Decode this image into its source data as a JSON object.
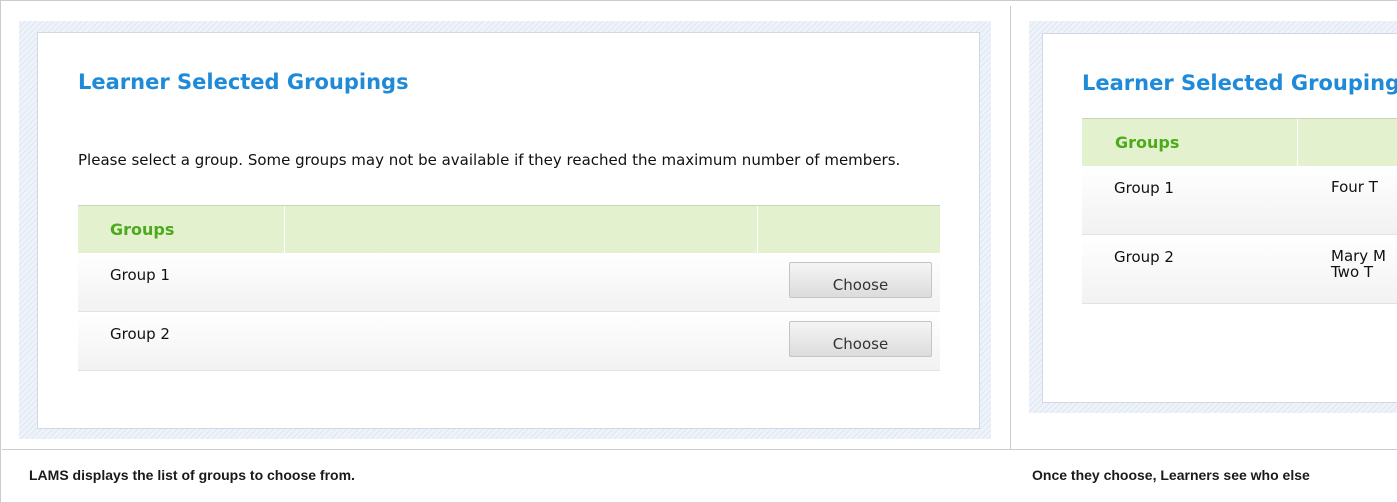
{
  "left_panel": {
    "title": "Learner Selected Groupings",
    "instructions": "Please select a group. Some groups may not be available if they reached the maximum number of members.",
    "table": {
      "header": "Groups",
      "rows": [
        {
          "name": "Group 1",
          "button": "Choose"
        },
        {
          "name": "Group 2",
          "button": "Choose"
        }
      ]
    },
    "caption": "LAMS displays the list of groups to choose from."
  },
  "right_panel": {
    "title": "Learner Selected Groupings",
    "table": {
      "header": "Groups",
      "rows": [
        {
          "name": "Group 1",
          "members": [
            "Four T"
          ]
        },
        {
          "name": "Group 2",
          "members": [
            "Mary M",
            "Two T"
          ]
        }
      ]
    },
    "caption": "Once they choose, Learners see who else"
  },
  "colors": {
    "title": "#1f8ad8",
    "table_header_bg": "#e3f1cf",
    "table_header_text": "#4caa1b"
  }
}
